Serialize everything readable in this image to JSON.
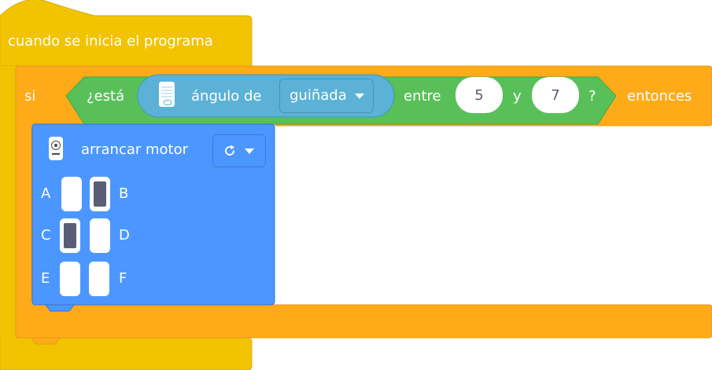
{
  "hat_block": {
    "label": "cuando se inicia el programa",
    "color": "#f2c300"
  },
  "if_block": {
    "si_label": "si",
    "then_label": "entonces",
    "color": "#ffab19"
  },
  "condition": {
    "prefix": "¿está",
    "sensor_label": "ángulo de",
    "axis_value": "guiñada",
    "between_label": "entre",
    "low_value": "5",
    "and_label": "y",
    "high_value": "7",
    "suffix": "?",
    "color": "#59c059",
    "sensor_color": "#5cb1d6"
  },
  "motor_block": {
    "label": "arrancar motor",
    "direction_icon": "clockwise-arrow-icon",
    "color": "#4c97ff",
    "ports": [
      {
        "left": "A",
        "right": "B",
        "left_selected": false,
        "right_selected": true
      },
      {
        "left": "C",
        "right": "D",
        "left_selected": true,
        "right_selected": false
      },
      {
        "left": "E",
        "right": "F",
        "left_selected": false,
        "right_selected": false
      }
    ]
  }
}
